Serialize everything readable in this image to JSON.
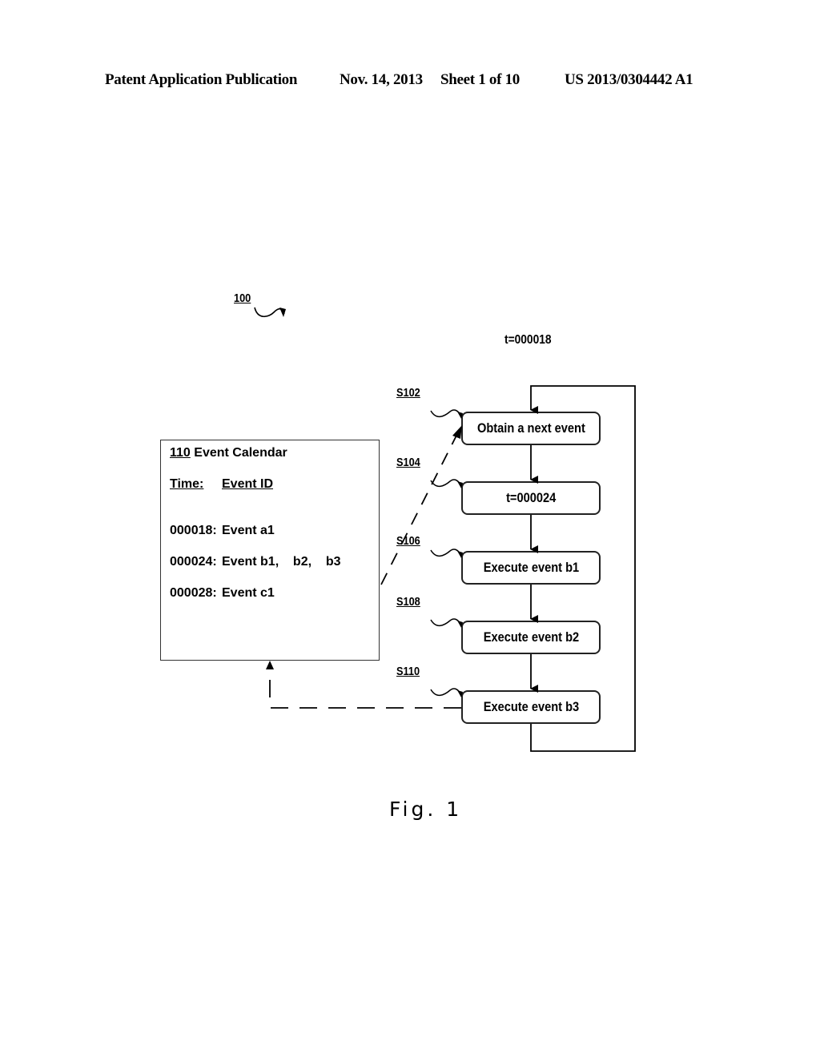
{
  "header": {
    "publication": "Patent Application Publication",
    "date": "Nov. 14, 2013",
    "sheet": "Sheet 1 of 10",
    "number": "US 2013/0304442 A1"
  },
  "figure": {
    "ref_system": "100",
    "time_label": "t=000018",
    "caption": "Fig. 1"
  },
  "calendar": {
    "ref": "110",
    "title": "Event Calendar",
    "col_time": "Time:",
    "col_event": "Event ID",
    "rows": [
      {
        "time": "000018:",
        "event": "Event a1"
      },
      {
        "time": "000024:",
        "event": "Event b1,    b2,    b3"
      },
      {
        "time": "000028:",
        "event": "Event c1"
      }
    ]
  },
  "steps": [
    {
      "id": "S102",
      "label": "Obtain a next event"
    },
    {
      "id": "S104",
      "label": "t=000024"
    },
    {
      "id": "S106",
      "label": "Execute event b1"
    },
    {
      "id": "S108",
      "label": "Execute event b2"
    },
    {
      "id": "S110",
      "label": "Execute event b3"
    }
  ]
}
